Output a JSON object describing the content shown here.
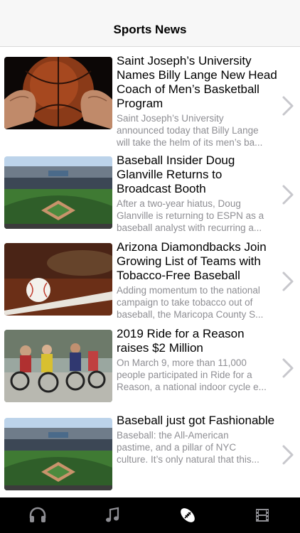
{
  "nav": {
    "title": "Sports News"
  },
  "articles": [
    {
      "headline": "Saint Joseph’s University Names Billy Lange New Head Coach of Men’s Basketball Program",
      "summary_line1": "Saint Joseph’s University",
      "summary_line2": "announced today that Billy Lange",
      "summary_line3": "will take the helm of its men’s ba...",
      "thumb_icon": "basketball-photo"
    },
    {
      "headline": "Baseball Insider Doug Glanville Returns to Broadcast Booth",
      "summary_line1": "After a two-year hiatus, Doug",
      "summary_line2": "Glanville is returning to ESPN as a",
      "summary_line3": "baseball analyst with recurring a...",
      "thumb_icon": "stadium-photo"
    },
    {
      "headline": "Arizona Diamondbacks Join Growing List of Teams with Tobacco-Free Baseball",
      "summary_line1": "Adding momentum to the national",
      "summary_line2": "campaign to take tobacco out of",
      "summary_line3": "baseball, the Maricopa County S...",
      "thumb_icon": "baseball-photo"
    },
    {
      "headline": "2019 Ride for a Reason raises $2 Million",
      "summary_line1": "On March 9, more than 11,000",
      "summary_line2": "people participated in Ride for a",
      "summary_line3": "Reason, a national indoor cycle e...",
      "thumb_icon": "cyclists-photo"
    },
    {
      "headline": "Baseball just got Fashionable",
      "summary_line1": "Baseball: the All-American",
      "summary_line2": "pastime, and a pillar of NYC",
      "summary_line3": "culture. It’s only natural that this...",
      "thumb_icon": "stadium-photo"
    }
  ],
  "tabbar": {
    "tabs": [
      {
        "icon": "headphones-icon",
        "selected": false
      },
      {
        "icon": "music-note-icon",
        "selected": false
      },
      {
        "icon": "football-icon",
        "selected": true
      },
      {
        "icon": "film-icon",
        "selected": false
      }
    ]
  },
  "colors": {
    "summary": "#8e8e93",
    "chevron": "#c7c7cc",
    "tab_inactive": "#8e8e93",
    "tab_active": "#ffffff"
  }
}
